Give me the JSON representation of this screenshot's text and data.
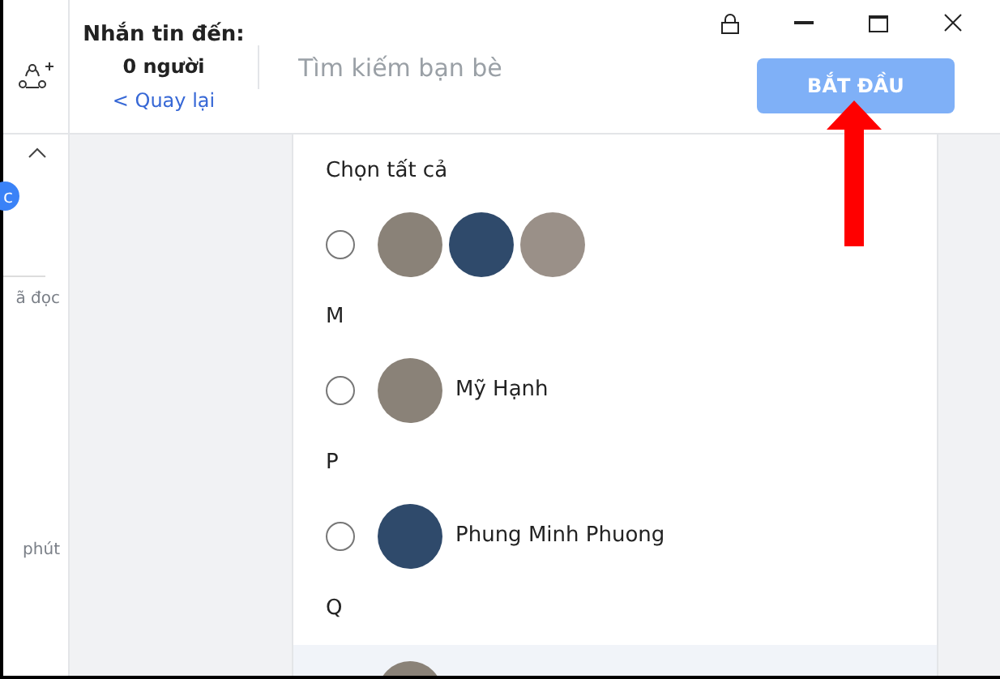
{
  "sidebar": {
    "badge": "c",
    "texts": [
      "ã đọc",
      "phút"
    ]
  },
  "header": {
    "recipients_label": "Nhắn tin đến:",
    "recipients_count": "0 người",
    "back_link": "< Quay lại",
    "search": {
      "placeholder": "Tìm kiếm bạn bè"
    },
    "start_button": {
      "label": "BẮT ĐẦU",
      "disabled": true
    }
  },
  "contacts": [
    {
      "kind": "label",
      "text": "Chọn tất cả"
    },
    {
      "kind": "group",
      "checked": false,
      "highlighted": false
    },
    {
      "kind": "label",
      "text": "M"
    },
    {
      "kind": "contact",
      "name": "Mỹ Hạnh",
      "checked": false,
      "highlighted": false
    },
    {
      "kind": "label",
      "text": "P"
    },
    {
      "kind": "contact",
      "name": "Phung Minh Phuong",
      "checked": false,
      "highlighted": false
    },
    {
      "kind": "label",
      "text": "Q"
    },
    {
      "kind": "contact",
      "highlighted": true
    }
  ]
}
